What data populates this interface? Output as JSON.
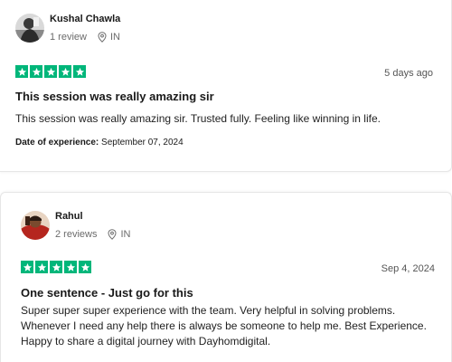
{
  "reviews": [
    {
      "reviewer_name": "Kushal Chawla",
      "review_count": "1 review",
      "country": "IN",
      "rating": 5,
      "posted": "5 days ago",
      "title": "This session was really amazing sir",
      "body": "This session was really amazing sir. Trusted fully. Feeling like winning in life.",
      "experience_label": "Date of experience:",
      "experience_date": "September 07, 2024"
    },
    {
      "reviewer_name": "Rahul",
      "review_count": "2 reviews",
      "country": "IN",
      "rating": 5,
      "posted": "Sep 4, 2024",
      "title": "One sentence - Just go for this",
      "body_lines": [
        "Super super super experience with the team. Very helpful in solving problems.",
        "Whenever I need any help there is always be someone to help me. Best Experience.",
        "Happy to share a digital journey with Dayhomdigital."
      ]
    }
  ],
  "colors": {
    "star_green": "#00b67a",
    "meta_gray": "#6b6b6b"
  },
  "icons": {
    "location": "location-pin-icon",
    "star": "star-icon"
  }
}
